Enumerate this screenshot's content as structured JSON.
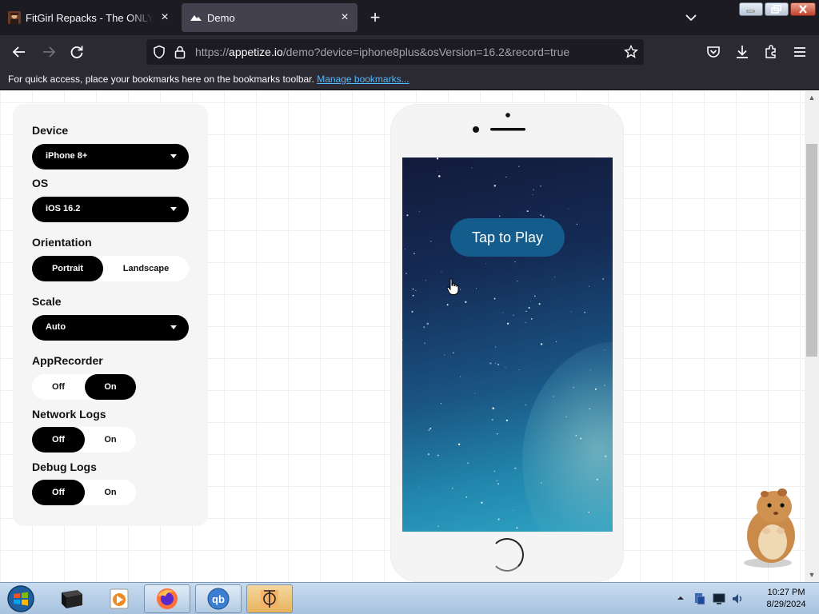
{
  "browser": {
    "tabs": [
      {
        "title": "FitGirl Repacks - The ONLY official site",
        "active": false,
        "favicon": "fitgirl-avatar-icon"
      },
      {
        "title": "Demo",
        "active": true,
        "favicon": "appetize-logo-icon"
      }
    ],
    "url": {
      "prefix": "https://",
      "host": "appetize.io",
      "path": "/demo?device=iphone8plus&osVersion=16.2&record=true"
    },
    "bookmarks_message": "For quick access, place your bookmarks here on the bookmarks toolbar.",
    "bookmarks_link": "Manage bookmarks..."
  },
  "panel": {
    "device": {
      "label": "Device",
      "value": "iPhone 8+"
    },
    "os": {
      "label": "OS",
      "value": "iOS 16.2"
    },
    "orientation": {
      "label": "Orientation",
      "options": [
        "Portrait",
        "Landscape"
      ],
      "selected": "Portrait"
    },
    "scale": {
      "label": "Scale",
      "value": "Auto"
    },
    "app_recorder": {
      "label": "AppRecorder",
      "options": [
        "Off",
        "On"
      ],
      "selected": "On"
    },
    "network_logs": {
      "label": "Network Logs",
      "options": [
        "Off",
        "On"
      ],
      "selected": "Off"
    },
    "debug_logs": {
      "label": "Debug Logs",
      "options": [
        "Off",
        "On"
      ],
      "selected": "Off"
    }
  },
  "phone": {
    "play_button": "Tap to Play"
  },
  "taskbar": {
    "items": [
      "terminal-icon",
      "media-player-icon",
      "firefox-icon",
      "qbittorrent-icon",
      "app-icon"
    ],
    "clock": {
      "time": "10:27 PM",
      "date": "8/29/2024"
    }
  },
  "colors": {
    "accent": "#000000",
    "link": "#53b8fd",
    "play_button": "#135c8c"
  }
}
